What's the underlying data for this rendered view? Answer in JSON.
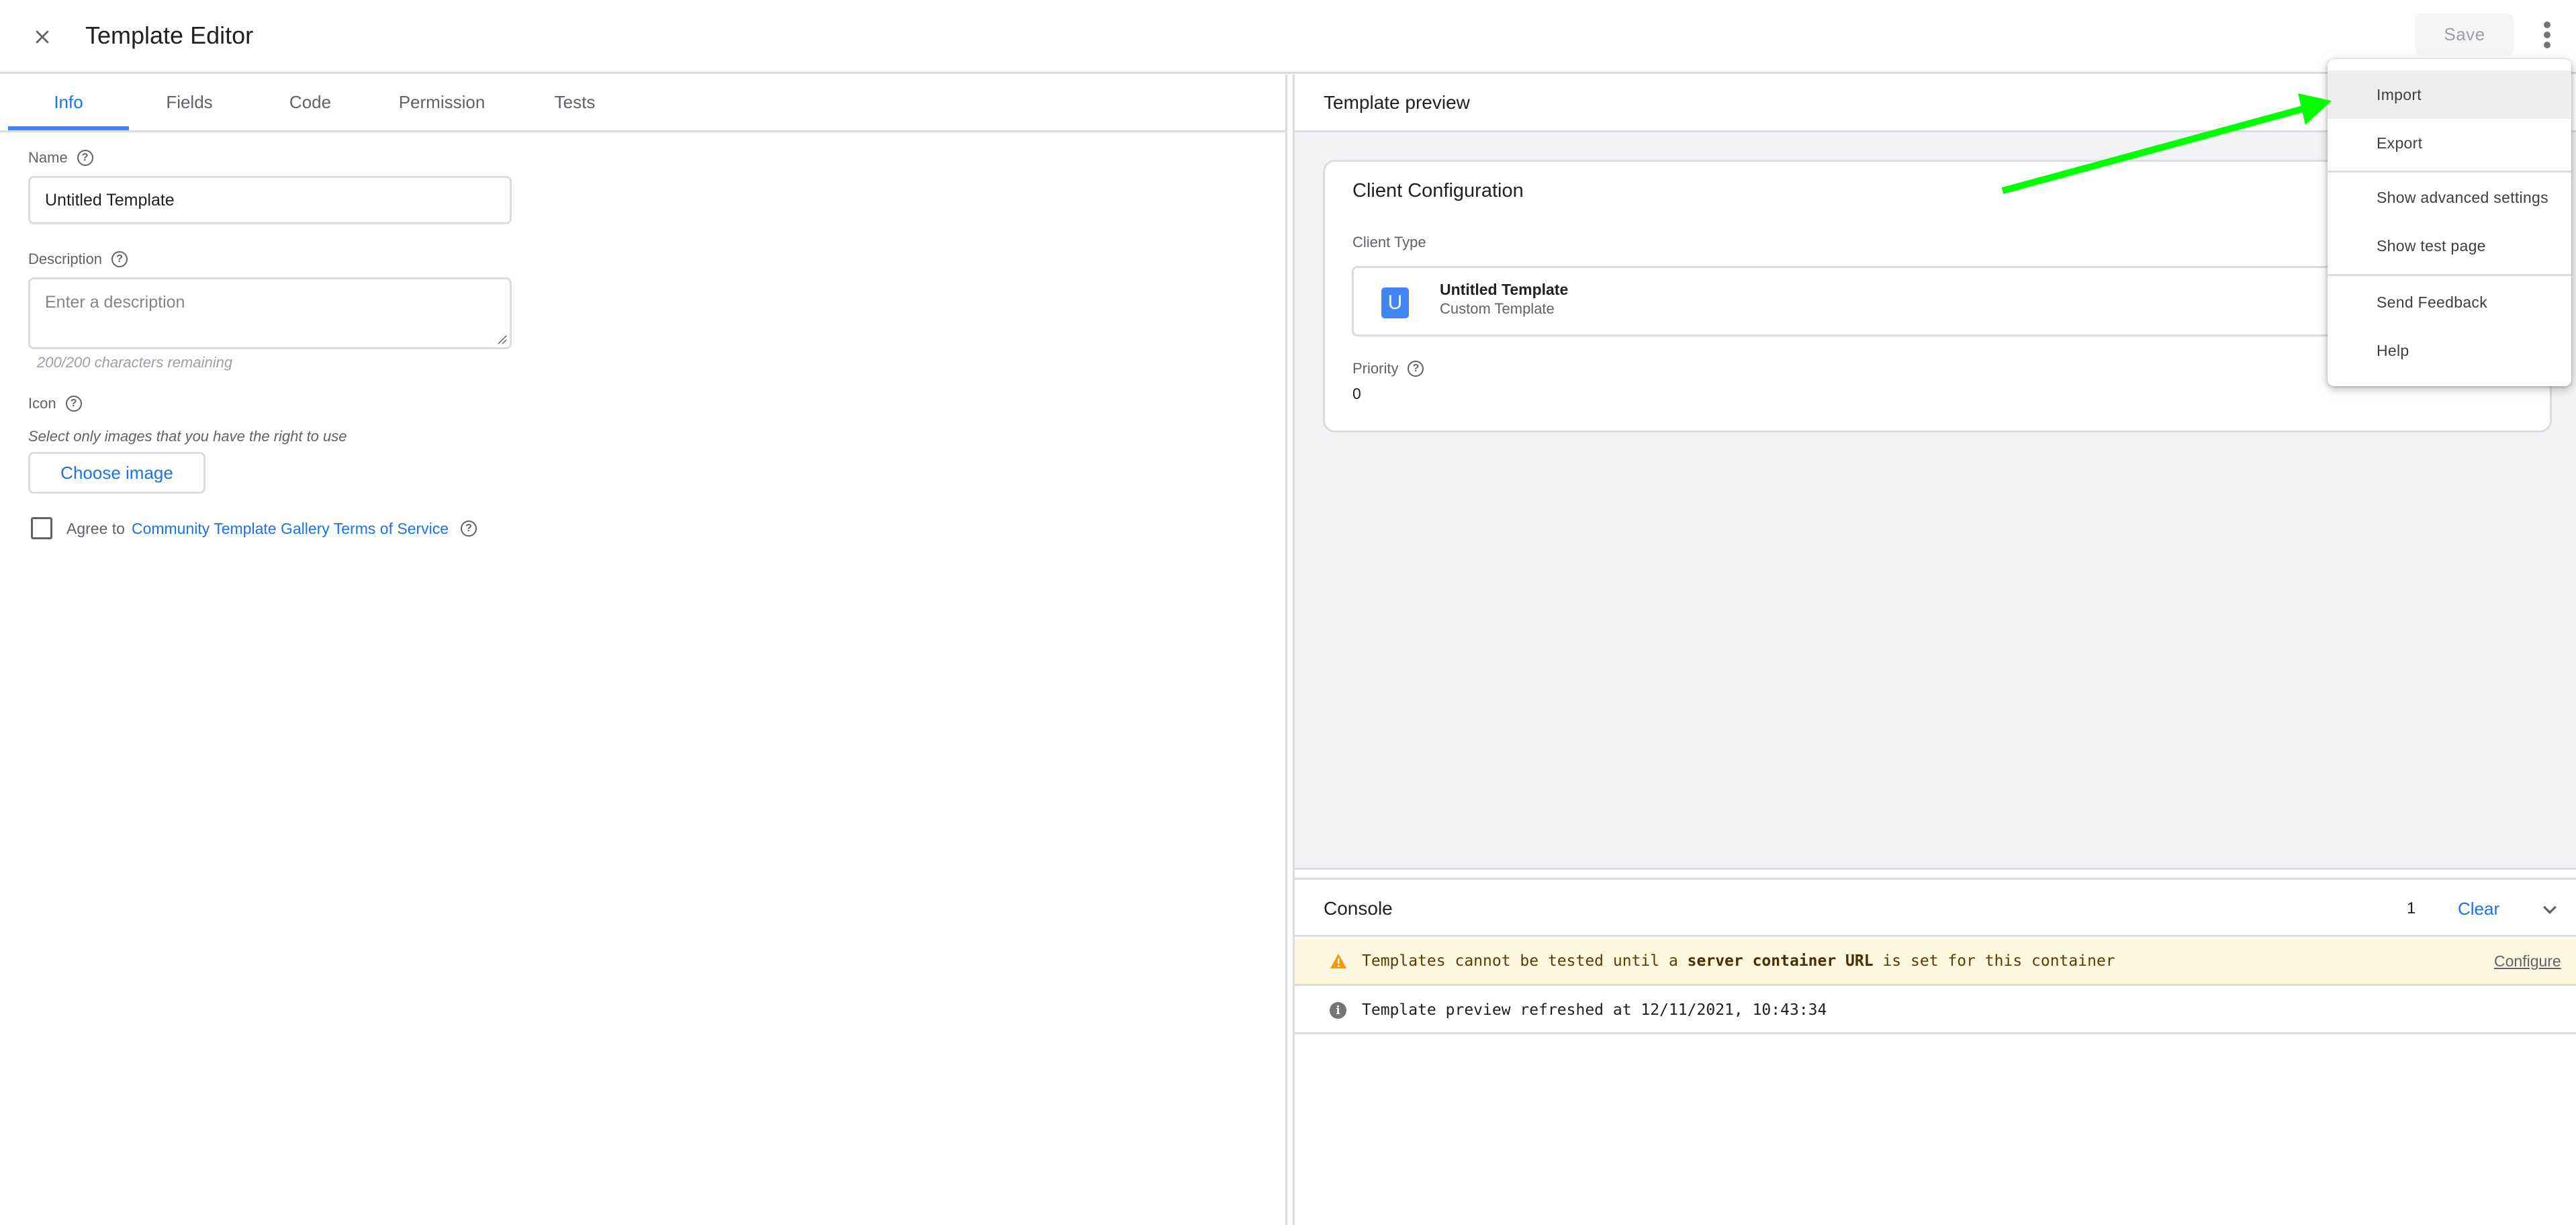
{
  "header": {
    "title": "Template Editor",
    "close_icon": "close-icon",
    "save_label": "Save",
    "more_icon": "more-vert-icon"
  },
  "tabs": [
    {
      "label": "Info",
      "active": true
    },
    {
      "label": "Fields",
      "active": false
    },
    {
      "label": "Code",
      "active": false
    },
    {
      "label": "Permission",
      "active": false
    },
    {
      "label": "Tests",
      "active": false
    }
  ],
  "form": {
    "name_label": "Name",
    "name_value": "Untitled Template",
    "description_label": "Description",
    "description_placeholder": "Enter a description",
    "char_count": "200/200 characters remaining",
    "icon_label": "Icon",
    "icon_note": "Select only images that you have the right to use",
    "choose_image_label": "Choose image",
    "agree_prefix": "Agree to",
    "agree_link": "Community Template Gallery Terms of Service",
    "agree_checked": false
  },
  "preview": {
    "title": "Template preview",
    "card_title": "Client Configuration",
    "client_type_label": "Client Type",
    "client_type_icon_letter": "U",
    "client_type_name": "Untitled Template",
    "client_type_sub": "Custom Template",
    "priority_label": "Priority",
    "priority_value": "0"
  },
  "console": {
    "title": "Console",
    "count": "1",
    "clear_label": "Clear",
    "warning": {
      "text_before": "Templates cannot be tested until a ",
      "text_bold": "server container URL",
      "text_after": " is set for this container",
      "action": "Configure"
    },
    "info": {
      "text": "Template preview refreshed at 12/11/2021, 10:43:34"
    }
  },
  "menu": {
    "items": [
      {
        "label": "Import",
        "highlighted": true
      },
      {
        "label": "Export"
      },
      {
        "label": "Show advanced settings"
      },
      {
        "label": "Show test page"
      },
      {
        "label": "Send Feedback"
      },
      {
        "label": "Help"
      }
    ]
  },
  "colors": {
    "accent": "#1a73e8",
    "tab_indicator": "#4285f4",
    "warning_bg": "#fef7e0",
    "warning_icon": "#f29900",
    "annotation_arrow": "#00ff00"
  }
}
